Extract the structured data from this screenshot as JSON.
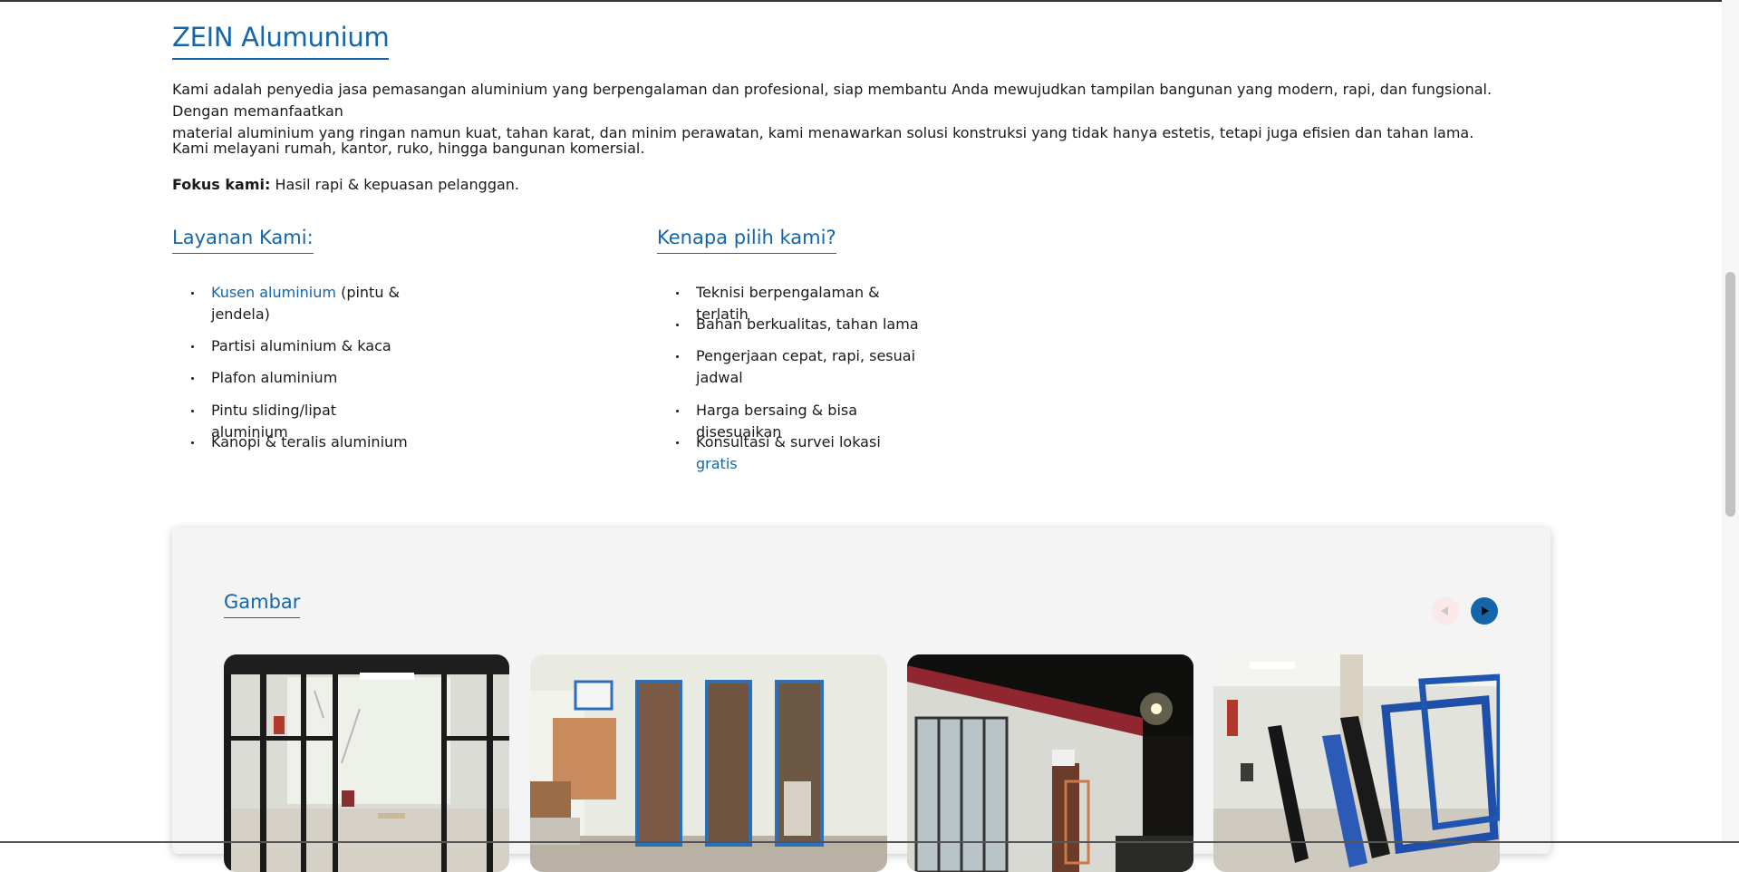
{
  "about": {
    "title": "ZEIN Alumunium",
    "paragraph1_line1": "Kami adalah penyedia jasa pemasangan aluminium yang berpengalaman dan profesional, siap membantu Anda mewujudkan tampilan bangunan yang modern, rapi, dan fungsional. Dengan memanfaatkan",
    "paragraph1_line2": "material aluminium yang ringan namun kuat, tahan karat, dan minim perawatan, kami menawarkan solusi konstruksi yang tidak hanya estetis, tetapi juga efisien dan tahan lama.",
    "paragraph2": "Kami melayani rumah, kantor, ruko, hingga bangunan komersial.",
    "focus_label": "Fokus kami:",
    "focus_text": " Hasil rapi & kepuasan pelanggan."
  },
  "services": {
    "heading": "Layanan Kami:",
    "item1_link": "Kusen aluminium",
    "item1_rest_a": " (pintu &",
    "item1_rest_b": "jendela)",
    "item2": "Partisi aluminium & kaca",
    "item3": "Plafon aluminium",
    "item4": "Pintu sliding/lipat aluminium",
    "item5": "Kanopi & teralis aluminium"
  },
  "why": {
    "heading": "Kenapa pilih kami?",
    "item1": "Teknisi berpengalaman & terlatih",
    "item2": "Bahan berkualitas, tahan lama",
    "item3_a": "Pengerjaan cepat, rapi, sesuai",
    "item3_b": "jadwal",
    "item4": "Harga bersaing & bisa disesuaikan",
    "item5_text": "Konsultasi & survei lokasi ",
    "item5_link": "gratis"
  },
  "gallery": {
    "heading": "Gambar",
    "prev_icon": "triangle-left-icon",
    "next_icon": "triangle-right-icon"
  },
  "colors": {
    "accent": "#1565a8",
    "text": "#1a1a1a",
    "gallery_bg": "#f4f4f4"
  }
}
